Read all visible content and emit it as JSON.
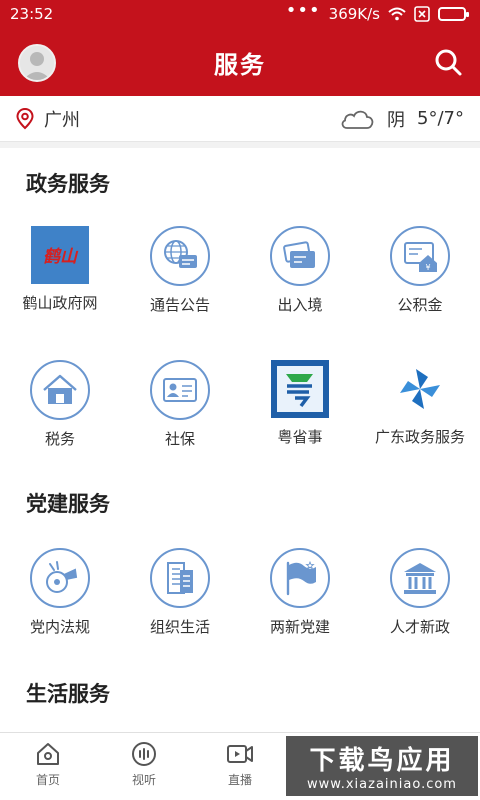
{
  "status": {
    "time": "23:52",
    "speed": "369K/s"
  },
  "header": {
    "title": "服务"
  },
  "location": {
    "city": "广州",
    "weather": "阴",
    "temp": "5°/7°"
  },
  "sections": {
    "gov": {
      "title": "政务服务",
      "items": [
        {
          "label": "鹤山政府网",
          "icon": "heshan-logo-icon",
          "logo_text": "鹤山"
        },
        {
          "label": "通告公告",
          "icon": "globe-chat-icon"
        },
        {
          "label": "出入境",
          "icon": "cards-icon"
        },
        {
          "label": "公积金",
          "icon": "house-fund-icon"
        },
        {
          "label": "税务",
          "icon": "house-icon"
        },
        {
          "label": "社保",
          "icon": "id-card-icon"
        },
        {
          "label": "粤省事",
          "icon": "yue-app-icon"
        },
        {
          "label": "广东政务服务",
          "icon": "pinwheel-icon"
        }
      ]
    },
    "party": {
      "title": "党建服务",
      "items": [
        {
          "label": "党内法规",
          "icon": "whistle-icon"
        },
        {
          "label": "组织生活",
          "icon": "building-icon"
        },
        {
          "label": "两新党建",
          "icon": "flag-icon"
        },
        {
          "label": "人才新政",
          "icon": "institution-icon"
        }
      ]
    },
    "life": {
      "title": "生活服务"
    }
  },
  "tabs": [
    {
      "label": "首页",
      "icon": "home-icon"
    },
    {
      "label": "视听",
      "icon": "audio-icon"
    },
    {
      "label": "直播",
      "icon": "video-icon"
    }
  ],
  "watermark": {
    "text": "下载鸟应用",
    "url": "www.xiazainiao.com"
  },
  "colors": {
    "brand": "#c4121c",
    "icon_blue": "#6a96cf"
  }
}
